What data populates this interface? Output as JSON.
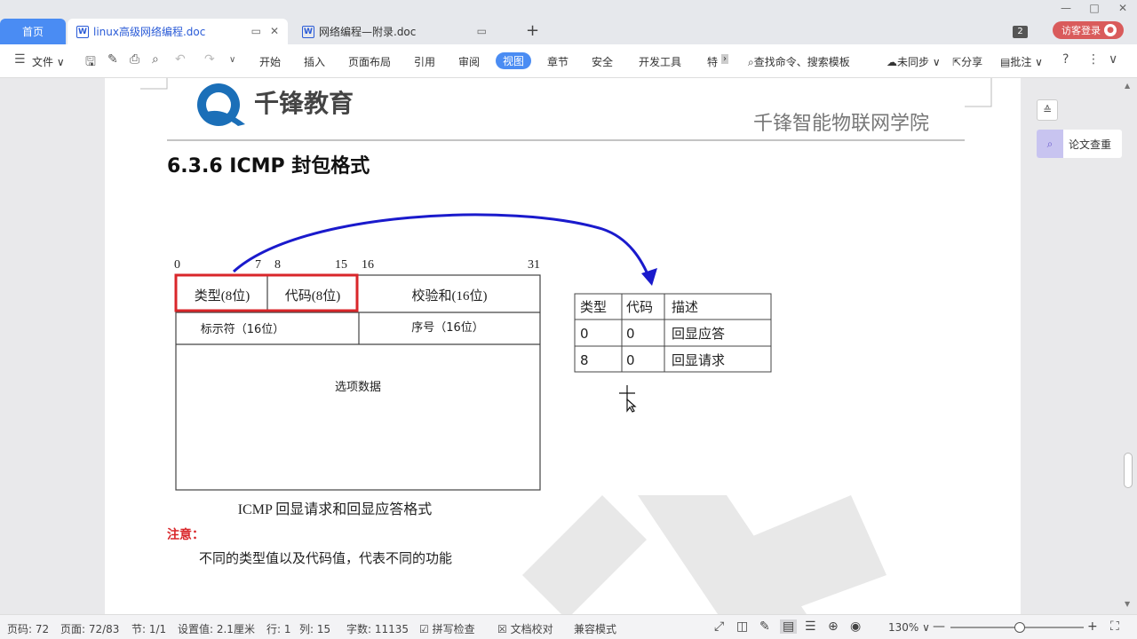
{
  "tabs": {
    "home": "首页",
    "doc1": "linux高级网络编程.doc",
    "doc2": "网络编程—附录.doc",
    "doc_icon": "W",
    "badge": "2",
    "guest": "访客登录"
  },
  "toolbar": {
    "file": "文件",
    "start": "开始",
    "insert": "插入",
    "layout": "页面布局",
    "reference": "引用",
    "review": "审阅",
    "view": "视图",
    "chapter": "章节",
    "security": "安全",
    "devtools": "开发工具",
    "special": "特",
    "search": "查找命令、搜索模板",
    "sync": "未同步",
    "share": "分享",
    "annotate": "批注"
  },
  "right_panel": {
    "essay_check": "论文查重"
  },
  "doc": {
    "org": "千锋教育",
    "school": "千锋智能物联网学院",
    "heading": "6.3.6 ICMP 封包格式",
    "bits": {
      "b0": "0",
      "b7": "7",
      "b8": "8",
      "b15": "15",
      "b16": "16",
      "b31": "31"
    },
    "fields": {
      "type": "类型(8位)",
      "code": "代码(8位)",
      "checksum": "校验和(16位)",
      "identifier": "标示符（16位）",
      "sequence": "序号（16位）",
      "options": "选项数据"
    },
    "caption": "ICMP 回显请求和回显应答格式",
    "note_label": "注意：",
    "note_text": "不同的类型值以及代码值，代表不同的功能"
  },
  "table": {
    "headers": [
      "类型",
      "代码",
      "描述"
    ],
    "rows": [
      [
        "0",
        "0",
        "回显应答"
      ],
      [
        "8",
        "0",
        "回显请求"
      ]
    ]
  },
  "status": {
    "page_code": "页码: 72",
    "page": "页面: 72/83",
    "section": "节: 1/1",
    "setting": "设置值: 2.1厘米",
    "row": "行: 1",
    "col": "列: 15",
    "words": "字数: 11135",
    "spell": "拼写检查",
    "proof": "文档校对",
    "compat": "兼容模式",
    "zoom": "130%"
  },
  "colors": {
    "accent": "#4a8cf3",
    "arrow": "#1a1acc",
    "highlight": "#d9262a",
    "note": "#d9262a"
  }
}
